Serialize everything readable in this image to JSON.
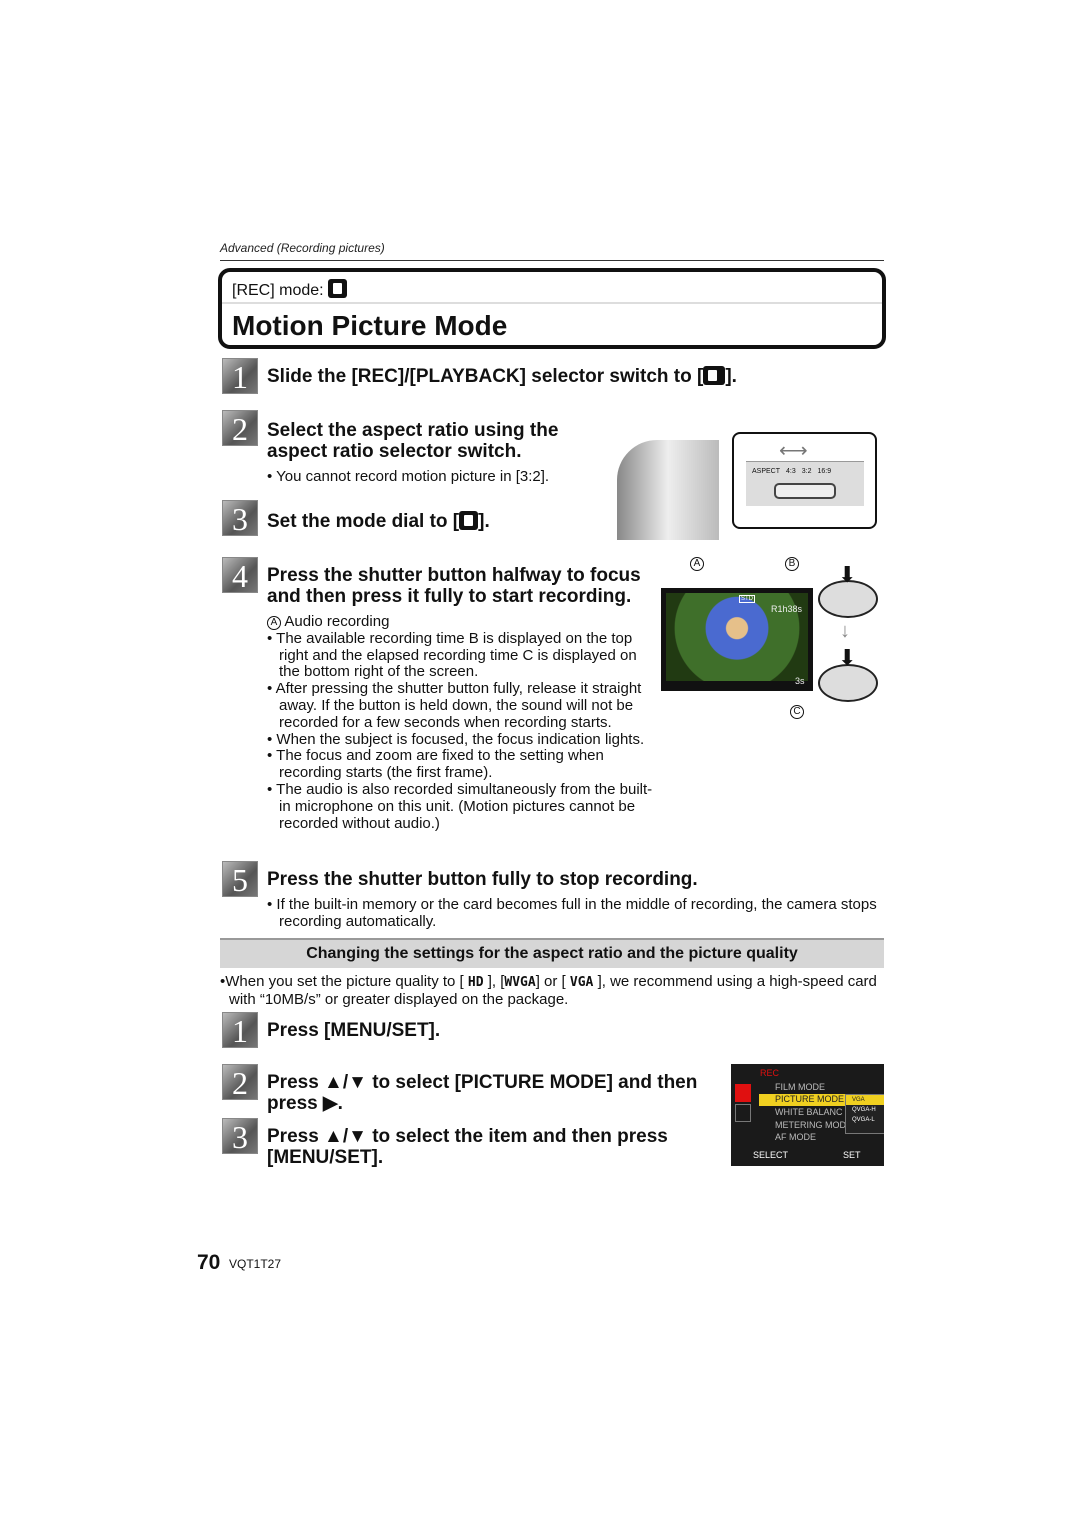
{
  "header": {
    "breadcrumb": "Advanced (Recording pictures)",
    "rec_mode": "[REC] mode:",
    "rec_mode_icon": "motion-picture-icon",
    "title": "Motion Picture Mode"
  },
  "steps_a": [
    {
      "n": "1",
      "text": "Slide the [REC]/[PLAYBACK] selector switch to [",
      "end": "]."
    },
    {
      "n": "2",
      "line1": "Select the aspect ratio using the",
      "line2": "aspect ratio selector switch.",
      "note": "You cannot record motion picture in [3:2]."
    },
    {
      "n": "3",
      "text": "Set the mode dial to [",
      "end": "]."
    },
    {
      "n": "4",
      "line1": "Press the shutter button halfway to focus",
      "line2": "and then press it fully to start recording.",
      "label_a": "Audio recording",
      "bullets": [
        "The available recording time B is displayed on the top right and the elapsed recording time C is displayed on the bottom right of the screen.",
        "After pressing the shutter button fully, release it straight away. If the button is held down, the sound will not be recorded for a few seconds when recording starts.",
        "When the subject is focused, the focus indication lights.",
        "The focus and zoom are fixed to the setting when recording starts (the first frame).",
        "The audio is also recorded simultaneously from the built-in microphone on this unit. (Motion pictures cannot be recorded without audio.)"
      ]
    },
    {
      "n": "5",
      "text": "Press the shutter button fully to stop recording.",
      "note": "If the built-in memory or the card becomes full in the middle of recording, the camera stops recording automatically."
    }
  ],
  "figure_aspect": {
    "labels": [
      "ASPECT",
      "4:3",
      "3:2",
      "16:9"
    ]
  },
  "figure_screen": {
    "callouts": [
      "A",
      "B",
      "C"
    ],
    "std": "STD",
    "time_remaining": "R1h38s",
    "elapsed": "3s"
  },
  "section": {
    "title": "Changing the settings for the aspect ratio and the picture quality",
    "note_pre": "When you set the picture quality to [",
    "hd": "HD",
    "mid1": "], [",
    "wvga": "WVGA",
    "mid2": "] or [",
    "vga": "VGA",
    "note_post": "], we recommend using a high-speed card with “10MB/s” or greater displayed on the package."
  },
  "steps_b": [
    {
      "n": "1",
      "text": "Press [MENU/SET]."
    },
    {
      "n": "2",
      "line1": "Press ▲/▼ to select [PICTURE MODE] and then",
      "line2": "press ▶."
    },
    {
      "n": "3",
      "line1": "Press ▲/▼ to select the item and then press",
      "line2": "[MENU/SET]."
    }
  ],
  "menu": {
    "tab": "REC",
    "items": [
      "FILM MODE",
      "PICTURE MODE",
      "WHITE BALANC",
      "METERING MOD",
      "AF MODE"
    ],
    "options": [
      "VGA",
      "QVGA-H",
      "QVGA-L"
    ],
    "select": "SELECT",
    "set": "SET",
    "highlight": "#f0d020",
    "accent": "#e01010"
  },
  "footer": {
    "page": "70",
    "code": "VQT1T27"
  }
}
